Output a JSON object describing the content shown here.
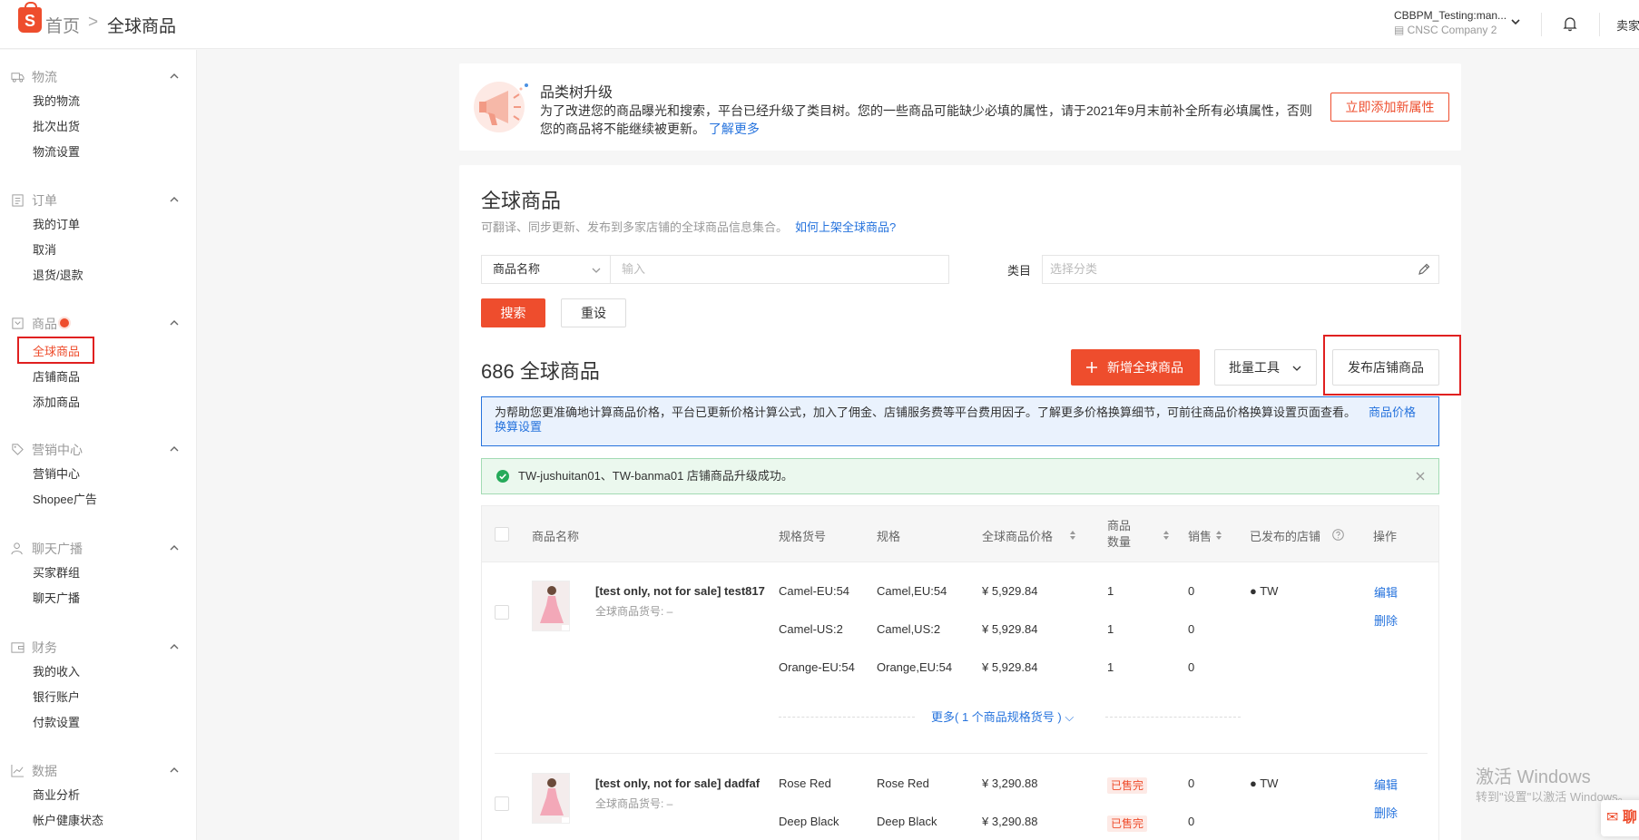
{
  "header": {
    "logo_letter": "S",
    "breadcrumb_home": "首页",
    "breadcrumb_sep": ">",
    "breadcrumb_current": "全球商品",
    "account_name": "CBBPM_Testing:man...",
    "account_company": "CNSC Company 2",
    "seller_label": "卖家"
  },
  "sidebar": [
    {
      "title": "物流",
      "icon": "truck-icon",
      "items": [
        "我的物流",
        "批次出货",
        "物流设置"
      ]
    },
    {
      "title": "订单",
      "icon": "clipboard-icon",
      "items": [
        "我的订单",
        "取消",
        "退货/退款"
      ]
    },
    {
      "title": "商品",
      "icon": "box-icon",
      "items": [
        "全球商品",
        "店铺商品",
        "添加商品"
      ],
      "active": "全球商品"
    },
    {
      "title": "营销中心",
      "icon": "tag-icon",
      "items": [
        "营销中心",
        "Shopee广告"
      ]
    },
    {
      "title": "聊天广播",
      "icon": "person-icon",
      "items": [
        "买家群组",
        "聊天广播"
      ]
    },
    {
      "title": "财务",
      "icon": "wallet-icon",
      "items": [
        "我的收入",
        "银行账户",
        "付款设置"
      ]
    },
    {
      "title": "数据",
      "icon": "chart-icon",
      "items": [
        "商业分析",
        "帐户健康状态"
      ]
    }
  ],
  "banner": {
    "title": "品类树升级",
    "text": "为了改进您的商品曝光和搜索，平台已经升级了类目树。您的一些商品可能缺少必填的属性，请于2021年9月末前补全所有必填属性，否则您的商品将不能继续被更新。",
    "link": "了解更多",
    "button": "立即添加新属性"
  },
  "page": {
    "title": "全球商品",
    "desc": "可翻译、同步更新、发布到多家店铺的全球商品信息集合。",
    "desc_link": "如何上架全球商品?"
  },
  "filters": {
    "field_select": "商品名称",
    "search_placeholder": "输入",
    "category_label": "类目",
    "category_placeholder": "选择分类",
    "search_button": "搜索",
    "reset_button": "重设"
  },
  "list": {
    "count_title": "686 全球商品",
    "add_button": "新增全球商品",
    "bulk_button": "批量工具",
    "publish_button": "发布店铺商品"
  },
  "notices": {
    "info": "为帮助您更准确地计算商品价格，平台已更新价格计算公式，加入了佣金、店铺服务费等平台费用因子。了解更多价格换算细节，可前往商品价格换算设置页面查看。",
    "info_link": "商品价格换算设置",
    "success": "TW-jushuitan01、TW-banma01 店铺商品升级成功。"
  },
  "table": {
    "headers": {
      "name": "商品名称",
      "sku": "规格货号",
      "variation": "规格",
      "price": "全球商品价格",
      "qty": "商品数量",
      "sales": "销售",
      "shops": "已发布的店铺",
      "actions": "操作"
    },
    "products": [
      {
        "name": "[test only, not for sale] test817",
        "global_sku": "全球商品货号: –",
        "shop": "TW",
        "edit": "编辑",
        "delete": "删除",
        "variants": [
          {
            "sku": "Camel-EU:54",
            "variation": "Camel,EU:54",
            "price": "¥ 5,929.84",
            "qty": "1",
            "sales": "0"
          },
          {
            "sku": "Camel-US:2",
            "variation": "Camel,US:2",
            "price": "¥ 5,929.84",
            "qty": "1",
            "sales": "0"
          },
          {
            "sku": "Orange-EU:54",
            "variation": "Orange,EU:54",
            "price": "¥ 5,929.84",
            "qty": "1",
            "sales": "0"
          }
        ],
        "more": "更多( 1 个商品规格货号 )"
      },
      {
        "name": "[test only, not for sale] dadfaf",
        "global_sku": "全球商品货号: –",
        "shop": "TW",
        "edit": "编辑",
        "delete": "删除",
        "variants": [
          {
            "sku": "Rose Red",
            "variation": "Rose Red",
            "price": "¥ 3,290.88",
            "qty": "已售完",
            "sales": "0"
          },
          {
            "sku": "Deep Black",
            "variation": "Deep Black",
            "price": "¥ 3,290.88",
            "qty": "已售完",
            "sales": "0"
          }
        ]
      }
    ]
  },
  "watermark": {
    "line1": "激活 Windows",
    "line2": "转到\"设置\"以激活 Windows。"
  },
  "float_chat_label": "聊",
  "colors": {
    "brand": "#ee4d2d",
    "link": "#2673dd",
    "highlight_box": "#e02020"
  }
}
